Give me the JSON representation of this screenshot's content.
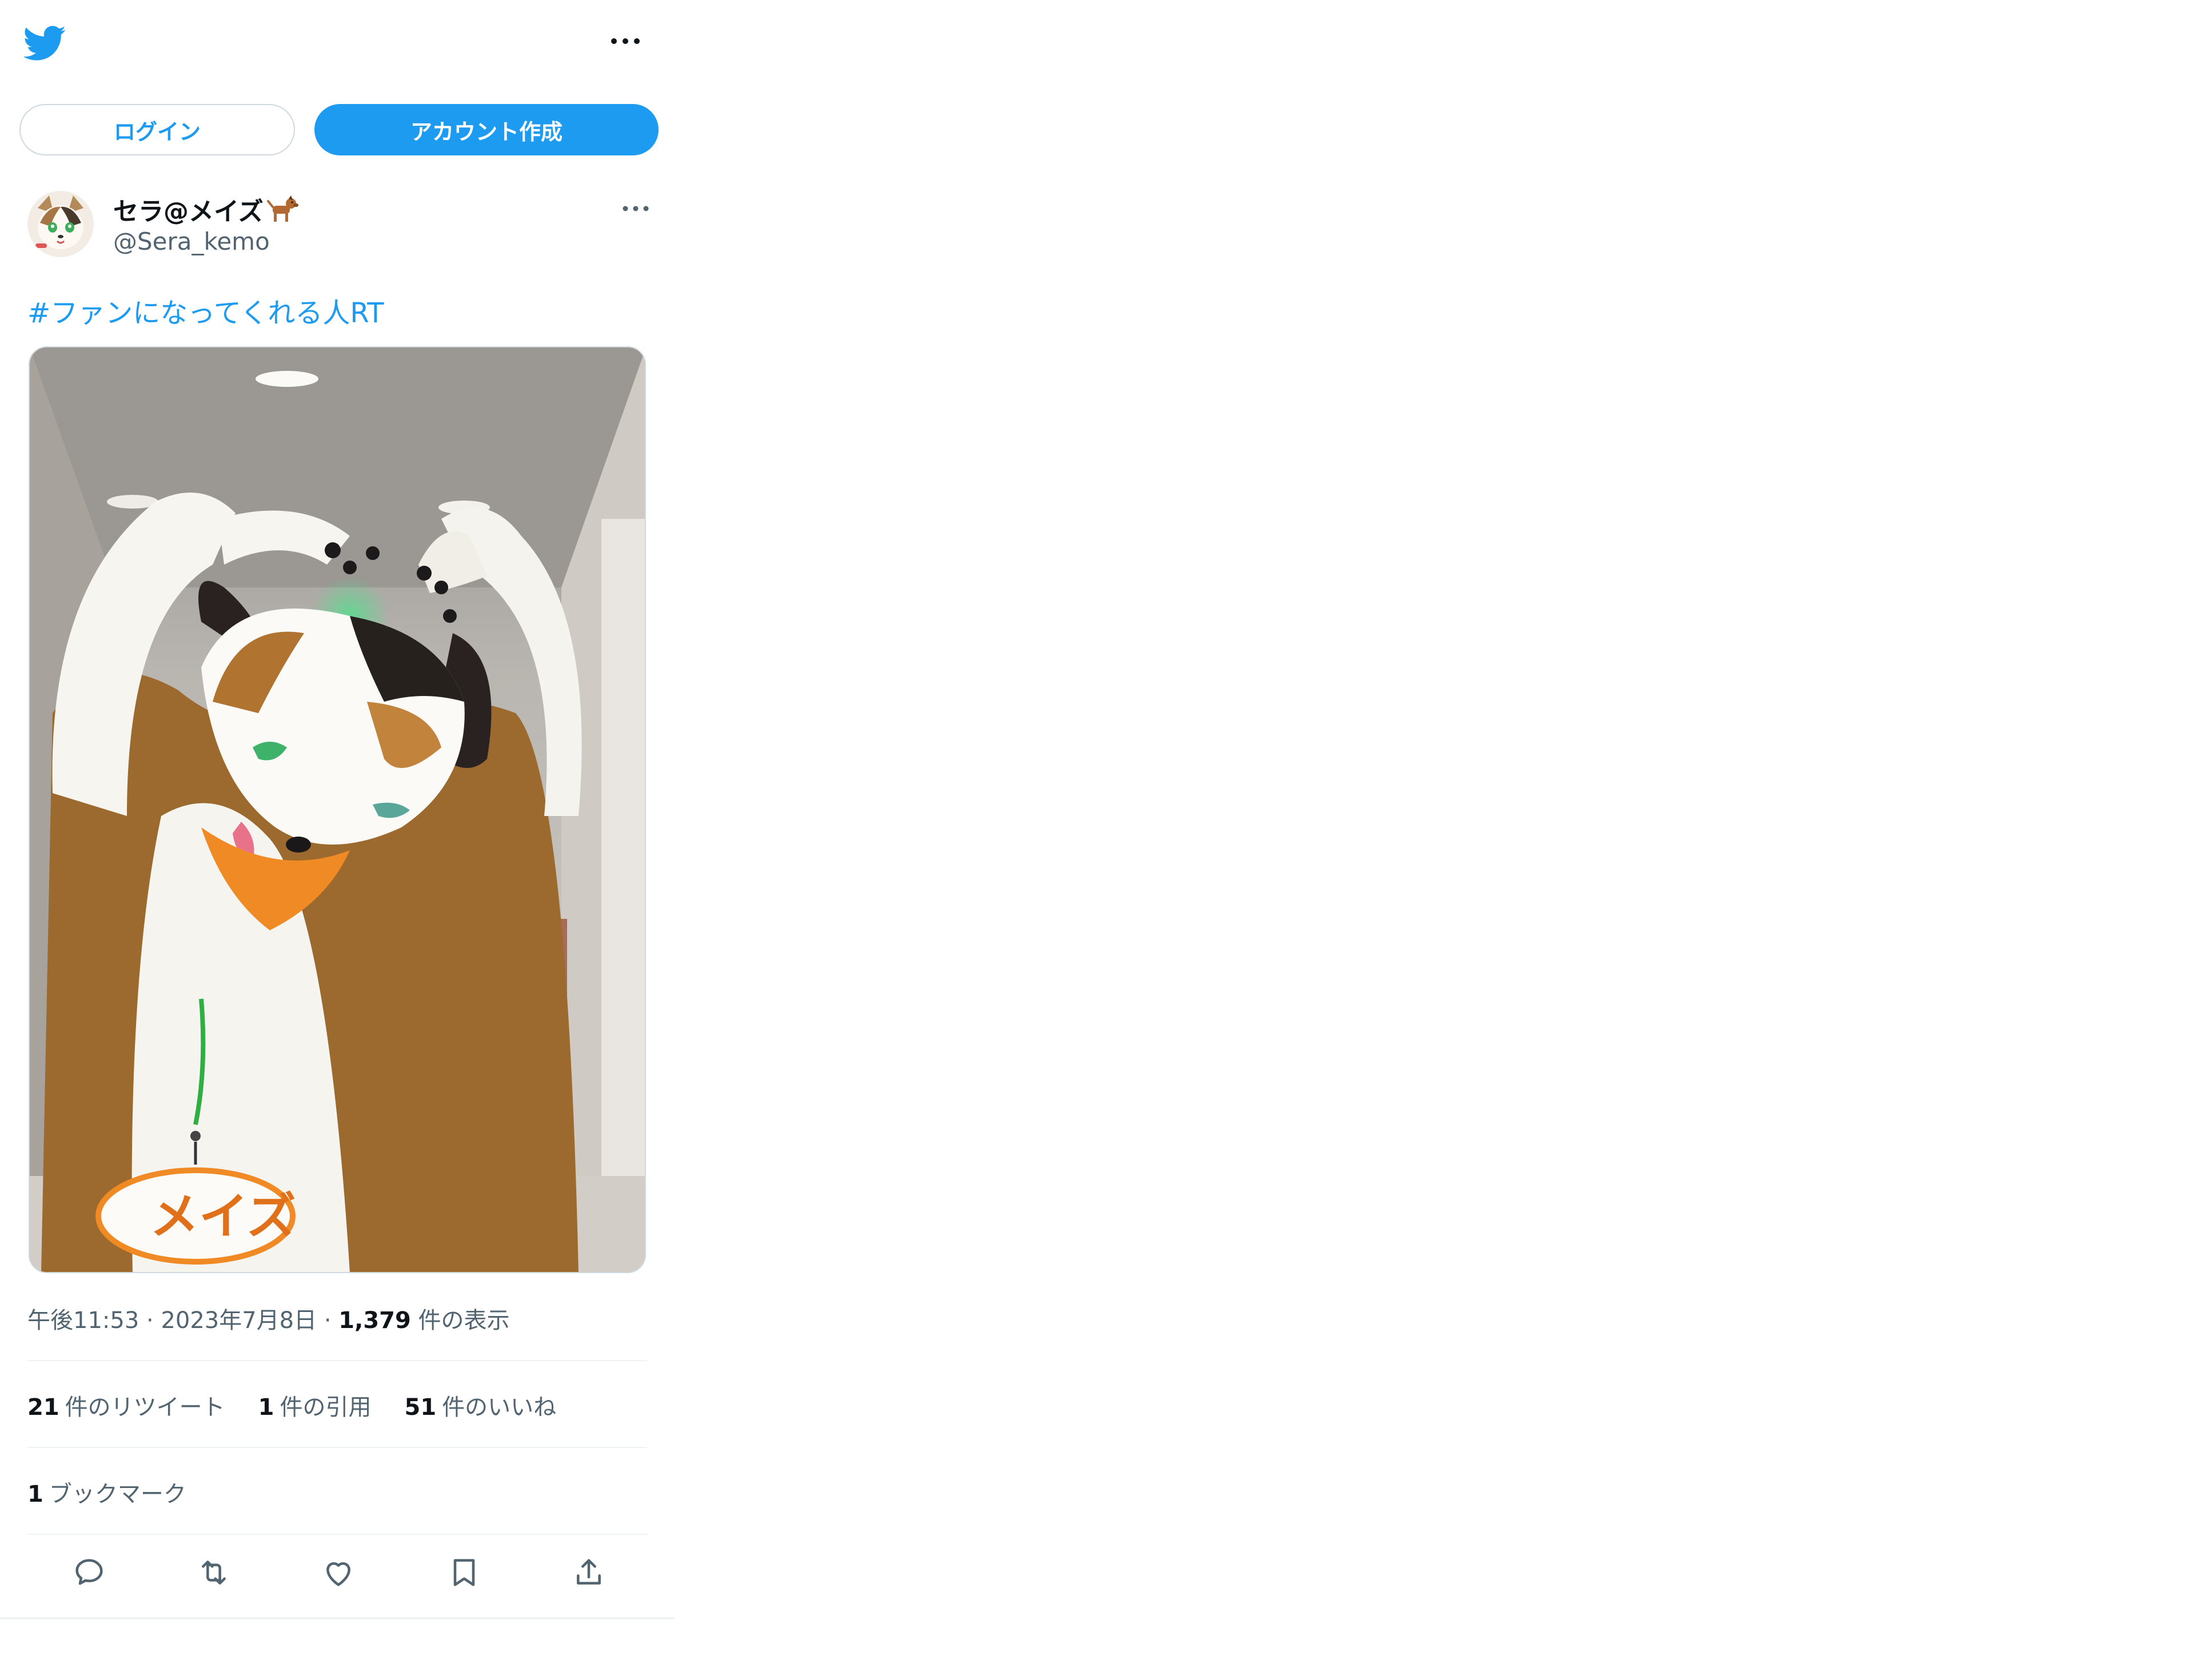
{
  "header": {
    "logo_icon": "twitter-bird-icon",
    "more_icon": "more-horizontal-icon"
  },
  "auth": {
    "login_label": "ログイン",
    "signup_label": "アカウント作成"
  },
  "tweet": {
    "author": {
      "display_name": "セラ@メイズ",
      "handle": "@Sera_kemo",
      "name_emoji_icon": "dog-icon"
    },
    "text": "#ファンになってくれる人RT",
    "media": {
      "badge_text": "メイズ"
    },
    "meta": {
      "time": "午後11:53",
      "separator": "·",
      "date": "2023年7月8日",
      "views_count": "1,379",
      "views_label": "件の表示"
    },
    "stats": {
      "retweets_count": "21",
      "retweets_label": "件のリツイート",
      "quotes_count": "1",
      "quotes_label": "件の引用",
      "likes_count": "51",
      "likes_label": "件のいいね",
      "bookmarks_count": "1",
      "bookmarks_label": "ブックマーク"
    },
    "actions": [
      "reply-icon",
      "retweet-icon",
      "like-icon",
      "bookmark-icon",
      "share-icon"
    ]
  },
  "colors": {
    "accent": "#1d9bf0",
    "text_primary": "#0f1419",
    "text_secondary": "#536471",
    "border": "#cfd9de",
    "divider": "#eff3f4"
  }
}
